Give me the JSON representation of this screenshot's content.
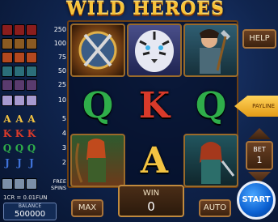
{
  "title": "WILD HEROES",
  "buttons": {
    "help": "HELP",
    "max": "MAX",
    "auto": "AUTO",
    "start": "START"
  },
  "paylines_label": "PAYLINE",
  "bet": {
    "label": "BET",
    "value": "1"
  },
  "win": {
    "label": "WIN",
    "value": "0"
  },
  "rate": "1CR = 0.01FUN",
  "balance": {
    "label": "BALANCE",
    "value": "500000"
  },
  "paytable": [
    {
      "icon": "wild-logo-icon",
      "value": "250"
    },
    {
      "icon": "shield-icon",
      "value": "100"
    },
    {
      "icon": "archer-icon",
      "value": "75"
    },
    {
      "icon": "heroine-icon",
      "value": "50"
    },
    {
      "icon": "warrior-icon",
      "value": "25"
    },
    {
      "icon": "tiger-icon",
      "value": "10"
    },
    {
      "icon": "letter-a",
      "letter": "A",
      "value": "5",
      "color": "#f3c342"
    },
    {
      "icon": "letter-k",
      "letter": "K",
      "value": "4",
      "color": "#d93a2a"
    },
    {
      "icon": "letter-q",
      "letter": "Q",
      "value": "3",
      "color": "#2fae4a"
    },
    {
      "icon": "letter-j",
      "letter": "J",
      "value": "2",
      "color": "#3f72d9"
    },
    {
      "icon": "scatter-icon",
      "value": "FREE SPINS"
    }
  ],
  "reels": [
    [
      {
        "type": "shield-icon"
      },
      {
        "type": "letter",
        "text": "Q",
        "color": "#2fae4a"
      },
      {
        "type": "archer-icon"
      }
    ],
    [
      {
        "type": "tiger-icon"
      },
      {
        "type": "letter",
        "text": "K",
        "color": "#d93a2a"
      },
      {
        "type": "letter",
        "text": "A",
        "color": "#f3c342"
      }
    ],
    [
      {
        "type": "warrior-icon"
      },
      {
        "type": "letter",
        "text": "Q",
        "color": "#2fae4a"
      },
      {
        "type": "heroine-icon"
      }
    ]
  ]
}
